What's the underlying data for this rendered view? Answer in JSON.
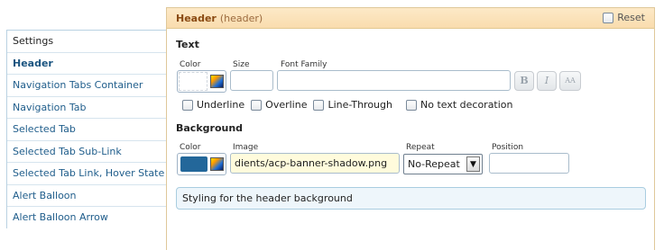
{
  "sidebar": {
    "items": [
      {
        "label": "Settings"
      },
      {
        "label": "Header"
      },
      {
        "label": "Navigation Tabs Container"
      },
      {
        "label": "Navigation Tab"
      },
      {
        "label": "Selected Tab"
      },
      {
        "label": "Selected Tab Sub-Link"
      },
      {
        "label": "Selected Tab Link, Hover State"
      },
      {
        "label": "Alert Balloon"
      },
      {
        "label": "Alert Balloon Arrow"
      }
    ],
    "active": "Header"
  },
  "panel": {
    "title": "Header",
    "subtitle": "(header)",
    "reset_label": "Reset"
  },
  "text_section": {
    "title": "Text",
    "color_label": "Color",
    "size_label": "Size",
    "font_family_label": "Font Family",
    "size_value": "",
    "font_family_value": "",
    "bold_icon": "B",
    "italic_icon": "I",
    "caps_icon": "AA",
    "decorations": {
      "underline": "Underline",
      "overline": "Overline",
      "line_through": "Line-Through",
      "none": "No text decoration"
    }
  },
  "background_section": {
    "title": "Background",
    "color_label": "Color",
    "image_label": "Image",
    "repeat_label": "Repeat",
    "position_label": "Position",
    "color_value": "#23679a",
    "image_value": "dients/acp-banner-shadow.png",
    "repeat_value": "No-Repeat",
    "position_value": ""
  },
  "description": "Styling for the header background",
  "colors": {
    "accent_link": "#1f5d8b",
    "panel_header_bg": "#fde9c7",
    "swatch_blue": "#23679a"
  }
}
